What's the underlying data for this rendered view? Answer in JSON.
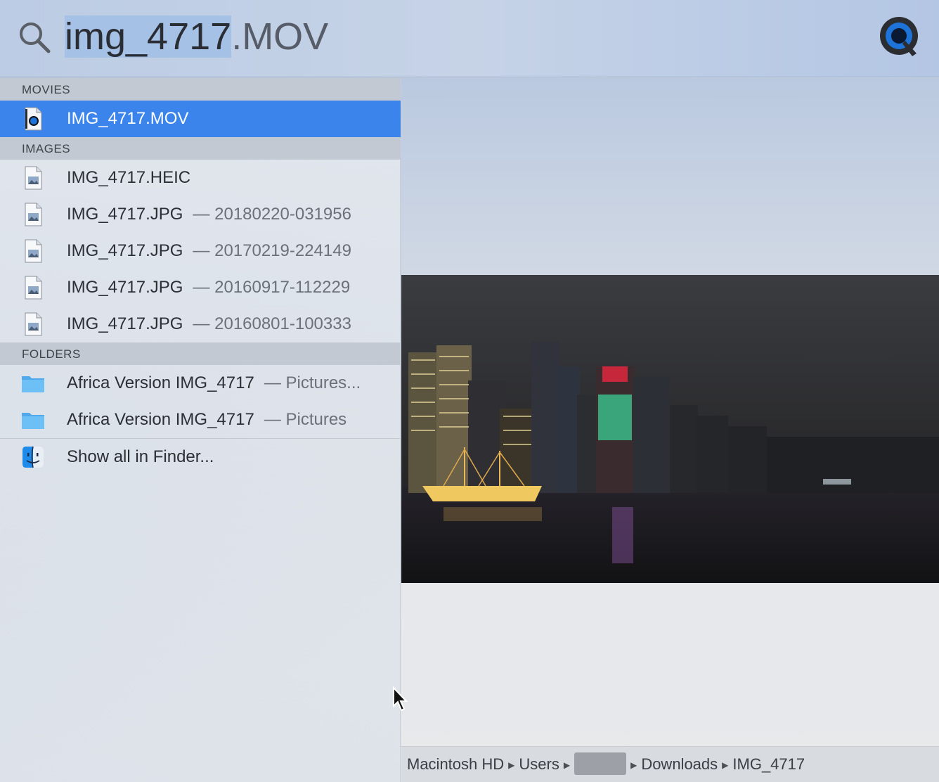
{
  "search": {
    "typed": "img_4717",
    "completion": ".MOV"
  },
  "results": {
    "sections": [
      {
        "header": "MOVIES",
        "items": [
          {
            "name": "IMG_4717.MOV",
            "detail": "",
            "icon": "quicktime-movie-file-icon",
            "selected": true
          }
        ]
      },
      {
        "header": "IMAGES",
        "items": [
          {
            "name": "IMG_4717.HEIC",
            "detail": "",
            "icon": "image-file-icon"
          },
          {
            "name": "IMG_4717.JPG",
            "detail": "— 20180220-031956",
            "icon": "image-file-icon"
          },
          {
            "name": "IMG_4717.JPG",
            "detail": "— 20170219-224149",
            "icon": "image-file-icon"
          },
          {
            "name": "IMG_4717.JPG",
            "detail": "— 20160917-112229",
            "icon": "image-file-icon"
          },
          {
            "name": "IMG_4717.JPG",
            "detail": "— 20160801-100333",
            "icon": "image-file-icon"
          }
        ]
      },
      {
        "header": "FOLDERS",
        "items": [
          {
            "name": "Africa Version IMG_4717",
            "detail": "— Pictures...",
            "icon": "folder-icon"
          },
          {
            "name": "Africa Version IMG_4717",
            "detail": "— Pictures",
            "icon": "folder-icon"
          }
        ]
      }
    ],
    "show_all": {
      "label": "Show all in Finder...",
      "icon": "finder-icon"
    }
  },
  "preview": {
    "image": "night-city-skyline-thumbnail",
    "path": [
      "Macintosh HD",
      "Users",
      "",
      "Downloads",
      "IMG_4717"
    ]
  },
  "colors": {
    "selection": "#3a84ec",
    "folder": "#5eb3f0",
    "quicktime_blue": "#1e73d9"
  }
}
